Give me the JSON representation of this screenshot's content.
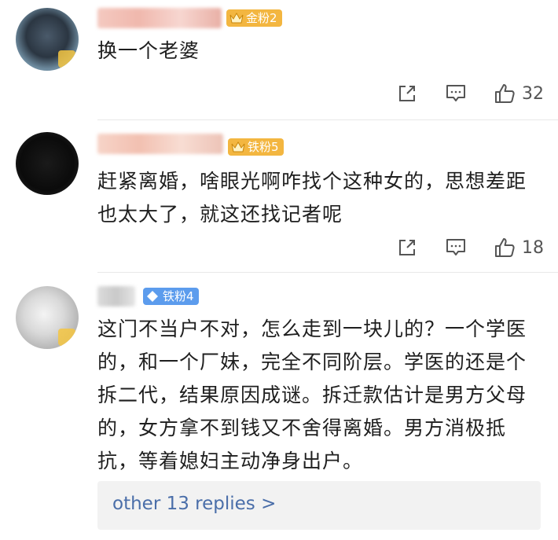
{
  "comments": [
    {
      "fan_badge": "金粉2",
      "text": "换一个老婆",
      "likes": "32"
    },
    {
      "fan_badge": "铁粉5",
      "text": "赶紧离婚，啥眼光啊咋找个这种女的，思想差距也太大了，就这还找记者呢",
      "likes": "18"
    },
    {
      "fan_badge": "铁粉4",
      "text": "这门不当户不对，怎么走到一块儿的？一个学医的，和一个厂妹，完全不同阶层。学医的还是个拆二代，结果原因成谜。拆迁款估计是男方父母的，女方拿不到钱又不舍得离婚。男方消极抵抗，等着媳妇主动净身出户。"
    }
  ],
  "replies_link": "other 13 replies >",
  "colors": {
    "gold_badge": "#f3b640",
    "blue_badge": "#5c9ced",
    "link": "#4a6ea9",
    "icon": "#555555"
  },
  "icons": [
    "share-icon",
    "comment-icon",
    "like-icon"
  ]
}
